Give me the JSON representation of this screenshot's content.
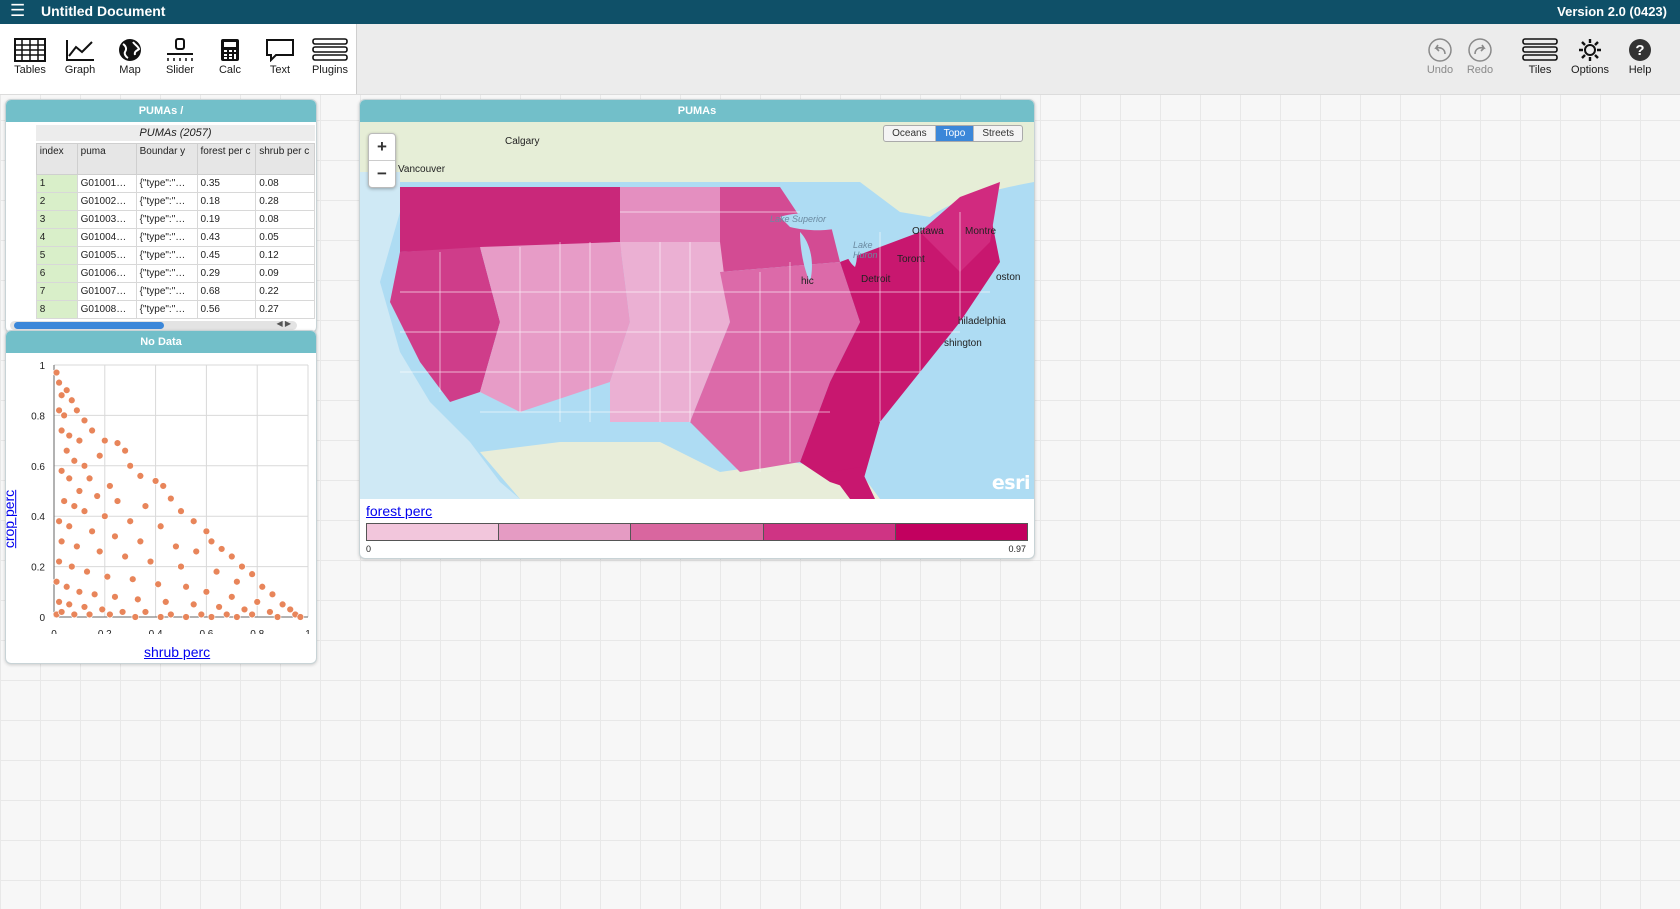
{
  "app": {
    "title": "Untitled Document",
    "version": "Version 2.0 (0423)"
  },
  "toolbar": {
    "left": [
      {
        "label": "Tables",
        "icon": "tables-icon"
      },
      {
        "label": "Graph",
        "icon": "graph-icon"
      },
      {
        "label": "Map",
        "icon": "map-globe-icon"
      },
      {
        "label": "Slider",
        "icon": "slider-icon"
      },
      {
        "label": "Calc",
        "icon": "calculator-icon"
      },
      {
        "label": "Text",
        "icon": "text-bubble-icon"
      },
      {
        "label": "Plugins",
        "icon": "plugins-icon"
      }
    ],
    "right": [
      {
        "label": "Undo",
        "icon": "undo-icon"
      },
      {
        "label": "Redo",
        "icon": "redo-icon"
      },
      {
        "label": "Tiles",
        "icon": "tiles-icon"
      },
      {
        "label": "Options",
        "icon": "gear-icon"
      },
      {
        "label": "Help",
        "icon": "help-icon"
      }
    ]
  },
  "table_tile": {
    "title": "PUMAs /",
    "collection": "PUMAs (2057)",
    "columns": [
      "index",
      "puma",
      "Boundar y",
      "forest per c",
      "shrub per c"
    ],
    "rows": [
      [
        "1",
        "G01001…",
        "{\"type\":\"…",
        "0.35",
        "0.08"
      ],
      [
        "2",
        "G01002…",
        "{\"type\":\"…",
        "0.18",
        "0.28"
      ],
      [
        "3",
        "G01003…",
        "{\"type\":\"…",
        "0.19",
        "0.08"
      ],
      [
        "4",
        "G01004…",
        "{\"type\":\"…",
        "0.43",
        "0.05"
      ],
      [
        "5",
        "G01005…",
        "{\"type\":\"…",
        "0.45",
        "0.12"
      ],
      [
        "6",
        "G01006…",
        "{\"type\":\"…",
        "0.29",
        "0.09"
      ],
      [
        "7",
        "G01007…",
        "{\"type\":\"…",
        "0.68",
        "0.22"
      ],
      [
        "8",
        "G01008…",
        "{\"type\":\"…",
        "0.56",
        "0.27"
      ]
    ]
  },
  "graph_tile": {
    "title": "No Data",
    "xlabel": "shrub perc",
    "ylabel": "crop perc"
  },
  "chart_data": {
    "type": "scatter",
    "xlabel": "shrub perc",
    "ylabel": "crop perc",
    "xlim": [
      0,
      1
    ],
    "ylim": [
      0,
      1
    ],
    "x_ticks": [
      "0",
      "0.2",
      "0.4",
      "0.6",
      "0.8",
      "1"
    ],
    "y_ticks": [
      "0",
      "0.2",
      "0.4",
      "0.6",
      "0.8",
      "1"
    ],
    "grid": true,
    "point_color": "#e8855a",
    "points": [
      [
        0.01,
        0.97
      ],
      [
        0.02,
        0.93
      ],
      [
        0.03,
        0.88
      ],
      [
        0.05,
        0.9
      ],
      [
        0.07,
        0.86
      ],
      [
        0.02,
        0.82
      ],
      [
        0.04,
        0.8
      ],
      [
        0.09,
        0.82
      ],
      [
        0.12,
        0.78
      ],
      [
        0.15,
        0.74
      ],
      [
        0.03,
        0.74
      ],
      [
        0.06,
        0.72
      ],
      [
        0.1,
        0.7
      ],
      [
        0.2,
        0.7
      ],
      [
        0.25,
        0.69
      ],
      [
        0.28,
        0.66
      ],
      [
        0.18,
        0.64
      ],
      [
        0.05,
        0.66
      ],
      [
        0.08,
        0.62
      ],
      [
        0.12,
        0.6
      ],
      [
        0.14,
        0.55
      ],
      [
        0.3,
        0.6
      ],
      [
        0.34,
        0.56
      ],
      [
        0.4,
        0.54
      ],
      [
        0.43,
        0.52
      ],
      [
        0.22,
        0.52
      ],
      [
        0.03,
        0.58
      ],
      [
        0.06,
        0.55
      ],
      [
        0.1,
        0.5
      ],
      [
        0.17,
        0.48
      ],
      [
        0.25,
        0.46
      ],
      [
        0.36,
        0.44
      ],
      [
        0.46,
        0.47
      ],
      [
        0.5,
        0.42
      ],
      [
        0.55,
        0.38
      ],
      [
        0.04,
        0.46
      ],
      [
        0.08,
        0.44
      ],
      [
        0.12,
        0.42
      ],
      [
        0.2,
        0.4
      ],
      [
        0.3,
        0.38
      ],
      [
        0.42,
        0.36
      ],
      [
        0.6,
        0.34
      ],
      [
        0.62,
        0.3
      ],
      [
        0.66,
        0.27
      ],
      [
        0.02,
        0.38
      ],
      [
        0.06,
        0.36
      ],
      [
        0.15,
        0.34
      ],
      [
        0.24,
        0.32
      ],
      [
        0.34,
        0.3
      ],
      [
        0.48,
        0.28
      ],
      [
        0.56,
        0.26
      ],
      [
        0.7,
        0.24
      ],
      [
        0.74,
        0.2
      ],
      [
        0.78,
        0.17
      ],
      [
        0.03,
        0.3
      ],
      [
        0.09,
        0.28
      ],
      [
        0.18,
        0.26
      ],
      [
        0.28,
        0.24
      ],
      [
        0.38,
        0.22
      ],
      [
        0.5,
        0.2
      ],
      [
        0.64,
        0.18
      ],
      [
        0.72,
        0.14
      ],
      [
        0.82,
        0.12
      ],
      [
        0.86,
        0.09
      ],
      [
        0.02,
        0.22
      ],
      [
        0.07,
        0.2
      ],
      [
        0.13,
        0.18
      ],
      [
        0.21,
        0.16
      ],
      [
        0.31,
        0.15
      ],
      [
        0.41,
        0.13
      ],
      [
        0.52,
        0.12
      ],
      [
        0.6,
        0.1
      ],
      [
        0.7,
        0.08
      ],
      [
        0.8,
        0.06
      ],
      [
        0.9,
        0.05
      ],
      [
        0.93,
        0.03
      ],
      [
        0.01,
        0.14
      ],
      [
        0.05,
        0.12
      ],
      [
        0.1,
        0.1
      ],
      [
        0.16,
        0.09
      ],
      [
        0.24,
        0.08
      ],
      [
        0.33,
        0.07
      ],
      [
        0.44,
        0.06
      ],
      [
        0.55,
        0.05
      ],
      [
        0.65,
        0.04
      ],
      [
        0.75,
        0.03
      ],
      [
        0.85,
        0.02
      ],
      [
        0.95,
        0.01
      ],
      [
        0.02,
        0.06
      ],
      [
        0.06,
        0.05
      ],
      [
        0.12,
        0.04
      ],
      [
        0.19,
        0.03
      ],
      [
        0.27,
        0.02
      ],
      [
        0.36,
        0.02
      ],
      [
        0.46,
        0.01
      ],
      [
        0.58,
        0.01
      ],
      [
        0.68,
        0.01
      ],
      [
        0.78,
        0.01
      ],
      [
        0.88,
        0.0
      ],
      [
        0.97,
        0.0
      ],
      [
        0.01,
        0.01
      ],
      [
        0.03,
        0.02
      ],
      [
        0.08,
        0.01
      ],
      [
        0.14,
        0.01
      ],
      [
        0.22,
        0.01
      ],
      [
        0.32,
        0.0
      ],
      [
        0.42,
        0.0
      ],
      [
        0.52,
        0.0
      ],
      [
        0.62,
        0.0
      ],
      [
        0.72,
        0.0
      ]
    ]
  },
  "map_tile": {
    "title": "PUMAs",
    "zoom_in": "+",
    "zoom_out": "−",
    "basemaps": [
      "Oceans",
      "Topo",
      "Streets"
    ],
    "active_basemap": "Topo",
    "cities": [
      "Calgary",
      "Vancouver",
      "Ottawa",
      "Montre",
      "Toront",
      "Detroit",
      "hic",
      "oston",
      "hiladelphia",
      "shington",
      "Lake Superior",
      "Lake Huron"
    ],
    "attribution": "esri",
    "legend_attribute": "forest perc",
    "legend_min": "0",
    "legend_max": "0.97",
    "legend_colors": [
      "#f2c6dc",
      "#e59bc3",
      "#d9669f",
      "#cf3484",
      "#c2005f"
    ]
  }
}
